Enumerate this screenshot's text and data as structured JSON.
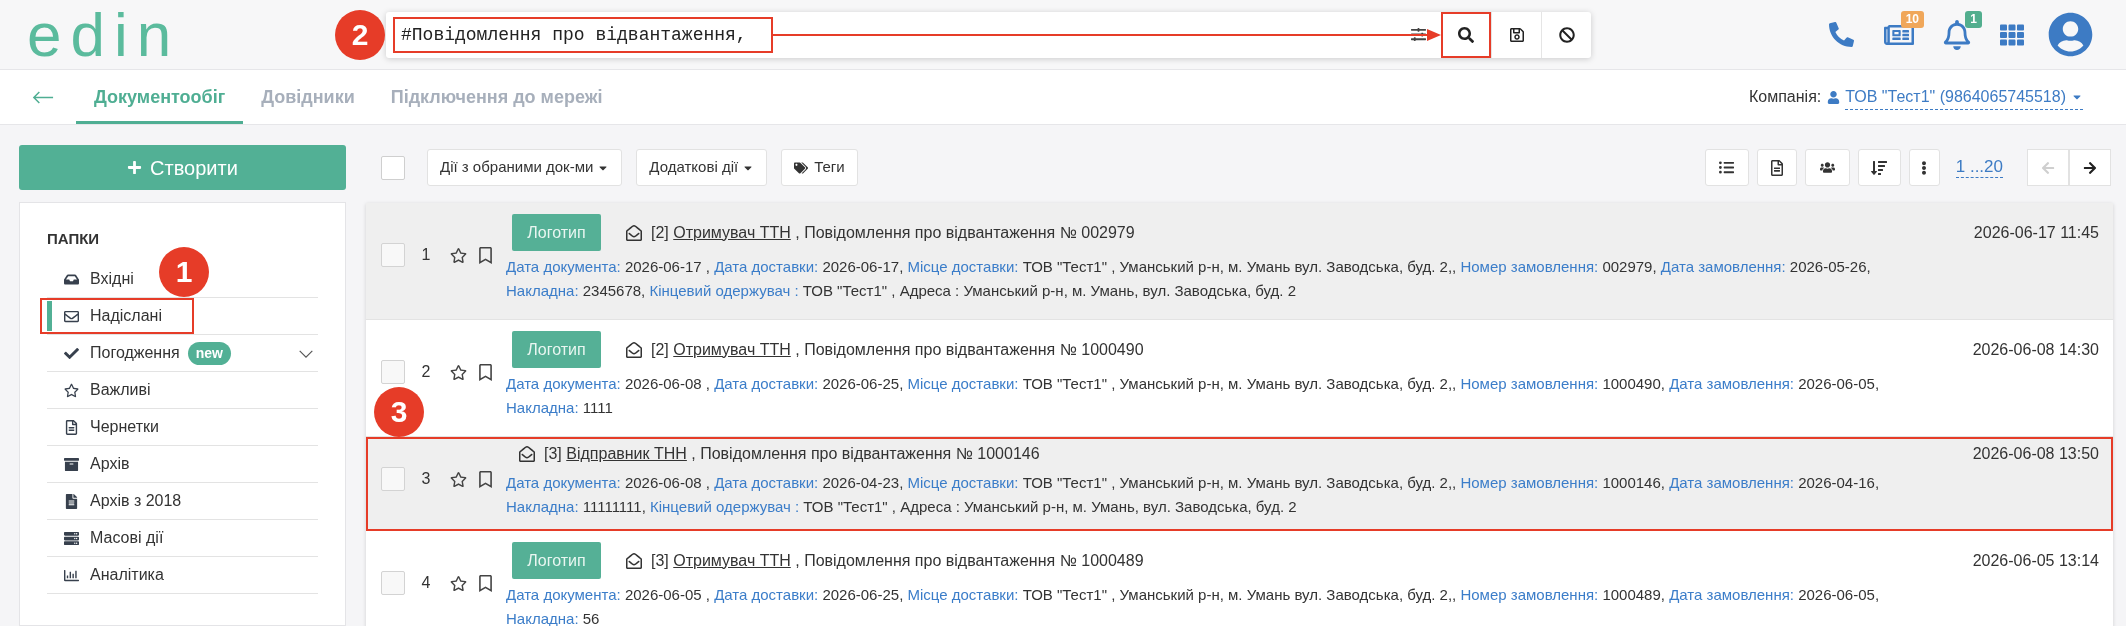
{
  "header": {
    "logo": "edin",
    "search": {
      "value": "#Повідомлення про відвантаження,",
      "annotated": true,
      "marker": "2",
      "arrow": true
    },
    "search_actions": [
      {
        "kind": "search",
        "annotated": true
      },
      {
        "kind": "save",
        "annotated": false
      },
      {
        "kind": "cancel",
        "annotated": false
      }
    ],
    "notifications": [
      {
        "kind": "news",
        "badge": "10",
        "color": "#f0a75a"
      },
      {
        "kind": "bell",
        "badge": "1",
        "color": "#52ae8e"
      }
    ]
  },
  "nav": {
    "tabs": [
      {
        "label": "Документообіг",
        "selected": true
      },
      {
        "label": "Довідники",
        "selected": false
      },
      {
        "label": "Підключення до мережі",
        "selected": false
      }
    ],
    "company_label": "Компанія:",
    "company": "ТОВ \"Тест1\" (9864065745518)"
  },
  "sidebar": {
    "create_button": "Створити",
    "title": "ПАПКИ",
    "items": [
      {
        "label": "Вхідні",
        "kind": "inbox",
        "selected": false,
        "annotated": false
      },
      {
        "label": "Надіслані",
        "kind": "sent",
        "selected": true,
        "annotated": true,
        "marker": "1"
      },
      {
        "label": "Погодження",
        "kind": "approval",
        "selected": false,
        "annotated": false,
        "badge": "new",
        "expanded": false
      },
      {
        "label": "Важливі",
        "kind": "important",
        "selected": false,
        "annotated": false
      },
      {
        "label": "Чернетки",
        "kind": "drafts",
        "selected": false,
        "annotated": false
      },
      {
        "label": "Архів",
        "kind": "archive",
        "selected": false,
        "annotated": false
      },
      {
        "label": "Архів з 2018",
        "kind": "archive_old",
        "selected": false,
        "annotated": false
      },
      {
        "label": "Масові дії",
        "kind": "bulk",
        "selected": false,
        "annotated": false
      },
      {
        "label": "Аналітика",
        "kind": "analytics",
        "selected": false,
        "annotated": false
      }
    ]
  },
  "toolbar": {
    "select_all_checked": false,
    "actions": [
      {
        "label": "Дії з обраними док-ми",
        "kind": "dropdown"
      },
      {
        "label": "Додаткові дії",
        "kind": "dropdown"
      },
      {
        "label": "Теги",
        "kind": "tags"
      }
    ],
    "page_range": "1 ...20",
    "pager": [
      {
        "kind": "prev",
        "disabled": true
      },
      {
        "kind": "next",
        "disabled": false
      }
    ]
  },
  "documents": [
    {
      "number": "1",
      "checked": false,
      "starred": false,
      "bookmarked": false,
      "highlighted": true,
      "annotated": false,
      "logo": "Логотип",
      "prefix": "[2]",
      "party": "Отримувач ТТН",
      "title": ", Повідомлення про відвантаження № 002979",
      "date": "2026-06-17 11:45",
      "details": [
        [
          {
            "label": "Дата документа:",
            "value": "2026-06-17 ,"
          },
          {
            "label": "Дата доставки:",
            "value": "2026-06-17,"
          },
          {
            "label": "Місце доставки:",
            "value": "ТОВ \"Тест1\" , Уманський р-н, м. Умань вул. Заводська, буд. 2,,"
          },
          {
            "label": "Номер замовлення:",
            "value": "002979,"
          },
          {
            "label": "Дата замовлення:",
            "value": "2026-05-26,"
          }
        ],
        [
          {
            "label": "Накладна:",
            "value": "2345678,"
          },
          {
            "label": "Кінцевий одержувач :",
            "value": "ТОВ \"Тест1\" , Адреса : Уманський р-н, м. Умань, вул. Заводська, буд. 2"
          }
        ]
      ]
    },
    {
      "number": "2",
      "checked": false,
      "starred": false,
      "bookmarked": false,
      "highlighted": false,
      "annotated": false,
      "logo": "Логотип",
      "prefix": "[2]",
      "party": "Отримувач ТТН",
      "title": ", Повідомлення про відвантаження № 1000490",
      "date": "2026-06-08 14:30",
      "details": [
        [
          {
            "label": "Дата документа:",
            "value": "2026-06-08 ,"
          },
          {
            "label": "Дата доставки:",
            "value": "2026-06-25,"
          },
          {
            "label": "Місце доставки:",
            "value": "ТОВ \"Тест1\" , Уманський р-н, м. Умань вул. Заводська, буд. 2,,"
          },
          {
            "label": "Номер замовлення:",
            "value": "1000490,"
          },
          {
            "label": "Дата замовлення:",
            "value": "2026-06-05,"
          }
        ],
        [
          {
            "label": "Накладна:",
            "value": "1111"
          }
        ]
      ]
    },
    {
      "number": "3",
      "checked": false,
      "starred": false,
      "bookmarked": false,
      "highlighted": true,
      "annotated": true,
      "marker": "3",
      "prefix": "[3]",
      "party": "Відправник ТНН",
      "title": ", Повідомлення про відвантаження № 1000146",
      "date": "2026-06-08 13:50",
      "details": [
        [
          {
            "label": "Дата документа:",
            "value": "2026-06-08 ,"
          },
          {
            "label": "Дата доставки:",
            "value": "2026-04-23,"
          },
          {
            "label": "Місце доставки:",
            "value": "ТОВ \"Тест1\" , Уманський р-н, м. Умань вул. Заводська, буд. 2,,"
          },
          {
            "label": "Номер замовлення:",
            "value": "1000146,"
          },
          {
            "label": "Дата замовлення:",
            "value": "2026-04-16,"
          }
        ],
        [
          {
            "label": "Накладна:",
            "value": "11111111,"
          },
          {
            "label": "Кінцевий одержувач :",
            "value": "ТОВ \"Тест1\" , Адреса : Уманський р-н, м. Умань, вул. Заводська, буд. 2"
          }
        ]
      ]
    },
    {
      "number": "4",
      "checked": false,
      "starred": false,
      "bookmarked": false,
      "highlighted": false,
      "annotated": false,
      "logo": "Логотип",
      "prefix": "[3]",
      "party": "Отримувач ТТН",
      "title": ", Повідомлення про відвантаження № 1000489",
      "date": "2026-06-05 13:14",
      "details": [
        [
          {
            "label": "Дата документа:",
            "value": "2026-06-05 ,"
          },
          {
            "label": "Дата доставки:",
            "value": "2026-06-25,"
          },
          {
            "label": "Місце доставки:",
            "value": "ТОВ \"Тест1\" , Уманський р-н, м. Умань вул. Заводська, буд. 2,,"
          },
          {
            "label": "Номер замовлення:",
            "value": "1000489,"
          },
          {
            "label": "Дата замовлення:",
            "value": "2026-06-05,"
          }
        ],
        [
          {
            "label": "Накладна:",
            "value": "56"
          }
        ]
      ]
    }
  ]
}
